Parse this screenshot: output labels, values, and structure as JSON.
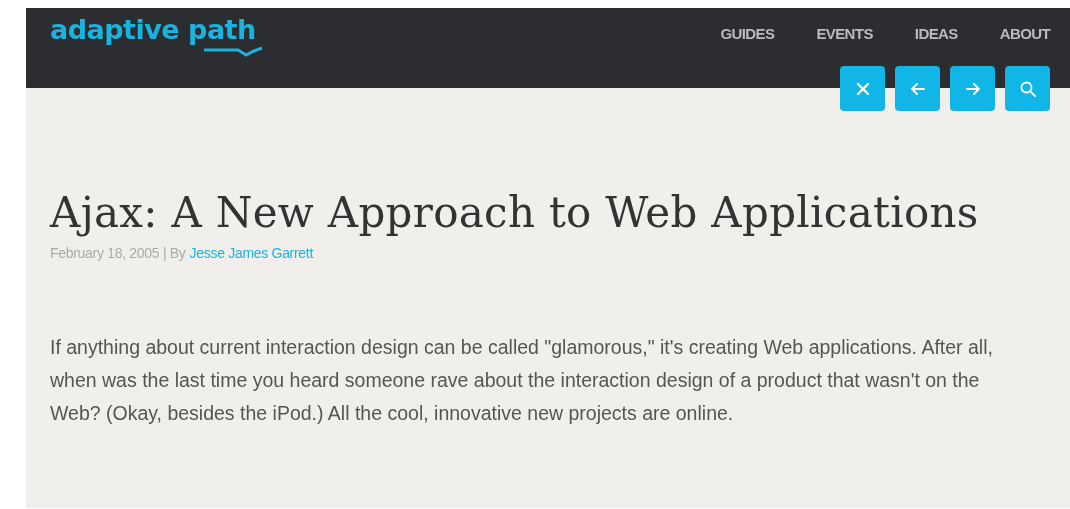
{
  "header": {
    "logo": "adaptive path",
    "nav": [
      {
        "label": "GUIDES"
      },
      {
        "label": "EVENTS"
      },
      {
        "label": "IDEAS"
      },
      {
        "label": "ABOUT"
      }
    ],
    "toolbar": [
      {
        "kind": "close"
      },
      {
        "kind": "back"
      },
      {
        "kind": "forward"
      },
      {
        "kind": "search"
      }
    ]
  },
  "article": {
    "title": "Ajax: A New Approach to Web Applications",
    "date": "February 18, 2005 | By",
    "author": "Jesse James Garrett",
    "body": "If anything about current interaction design can be called \"glamorous,\" it's creating Web applications. After all, when was the last time you heard someone rave about the interaction design of a product that wasn't on the Web? (Okay, besides the iPod.) All the cool, innovative new projects are online."
  }
}
